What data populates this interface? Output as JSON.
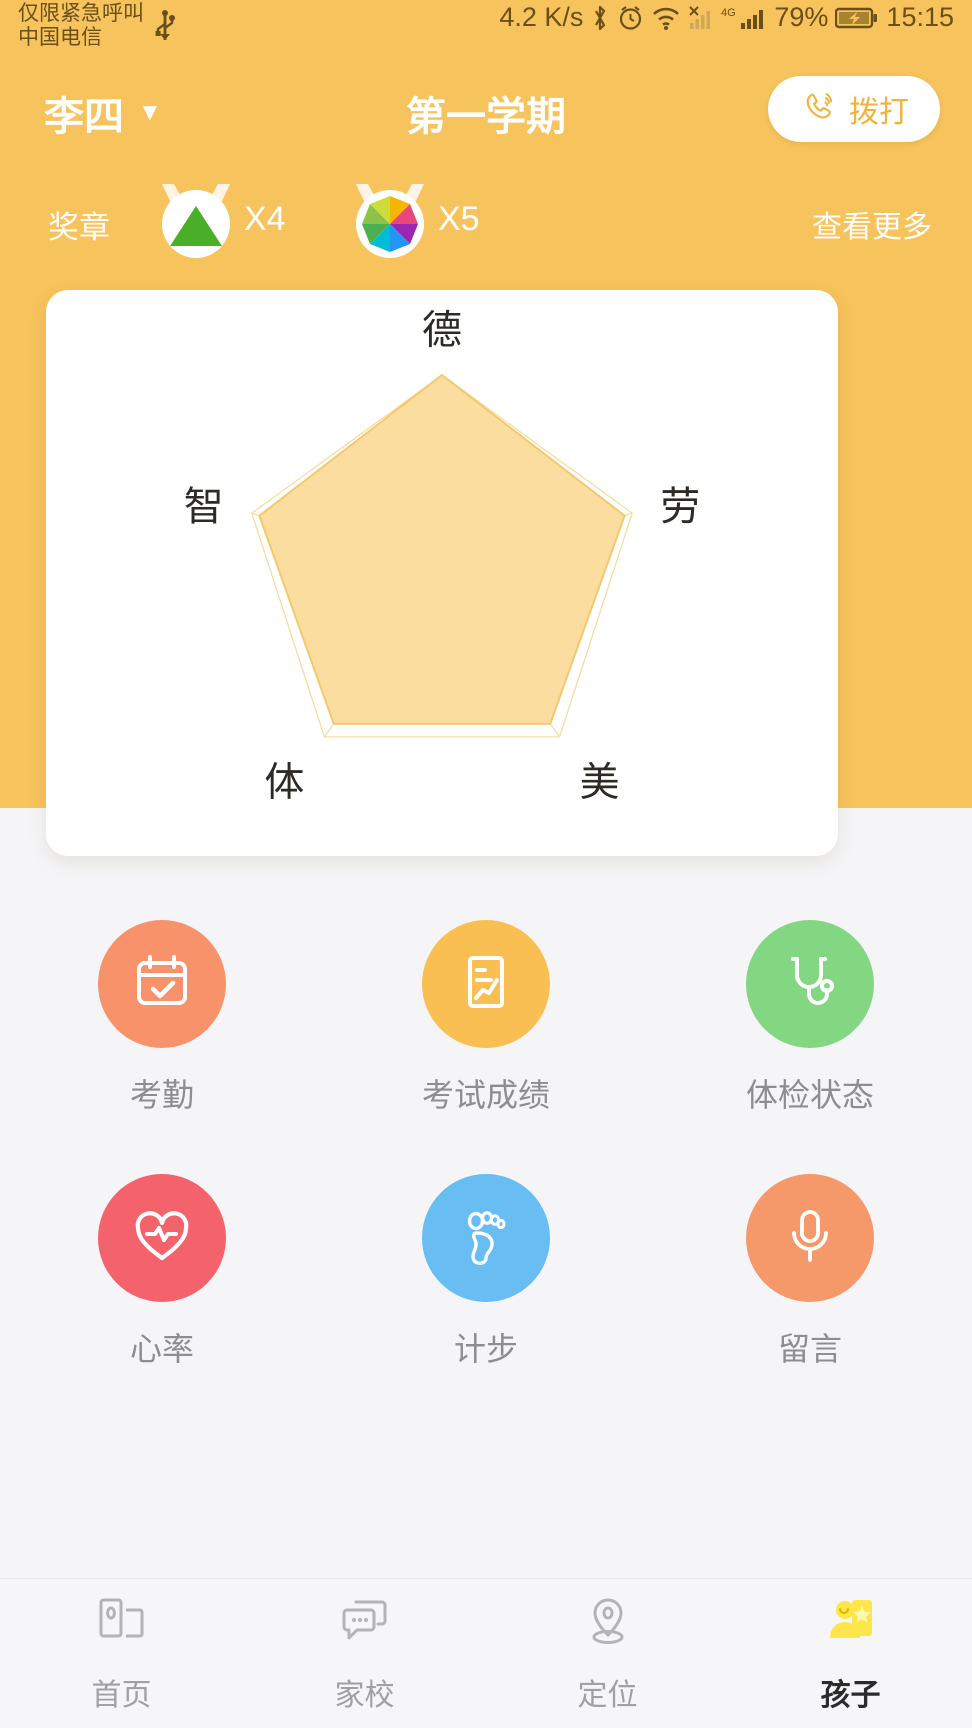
{
  "status_bar": {
    "carrier_line1": "仅限紧急呼叫",
    "carrier_line2": "中国电信",
    "usb_icon": "usb-icon",
    "net_speed": "4.2 K/s",
    "bluetooth_icon": "bluetooth-icon",
    "alarm_icon": "alarm-icon",
    "wifi_icon": "wifi-icon",
    "sim1_icon": "signal-no-service-icon",
    "network_type": "4G",
    "sim2_icon": "signal-bars-icon",
    "battery_percent": "79%",
    "battery_icon": "battery-charging-icon",
    "time": "15:15"
  },
  "header": {
    "child_name": "李四",
    "caret_icon": "chevron-down-icon",
    "term": "第一学期",
    "call_button": {
      "label": "拨打",
      "icon": "phone-call-icon"
    }
  },
  "medals": {
    "label": "奖章",
    "more_label": "查看更多",
    "items": [
      {
        "icon": "triangle-badge-icon",
        "count": "X4"
      },
      {
        "icon": "pinwheel-badge-icon",
        "count": "X5"
      }
    ]
  },
  "chart_data": {
    "type": "radar",
    "title": "",
    "categories": [
      "德",
      "劳",
      "美",
      "体",
      "智"
    ],
    "values": [
      100,
      96,
      92,
      92,
      96
    ],
    "rmax": 100,
    "rings": 5,
    "grid": true,
    "legend": "none",
    "fill_color": "#fbdda0",
    "line_color": "#f3c96e",
    "grid_color": "#f7d99c",
    "label_color": "#2e2a26"
  },
  "features": [
    {
      "label": "考勤",
      "icon": "calendar-check-icon",
      "color": "#f7926b"
    },
    {
      "label": "考试成绩",
      "icon": "report-chart-icon",
      "color": "#f9bf52"
    },
    {
      "label": "体检状态",
      "icon": "stethoscope-icon",
      "color": "#84d782"
    },
    {
      "label": "心率",
      "icon": "heart-pulse-icon",
      "color": "#f4636b"
    },
    {
      "label": "计步",
      "icon": "footprint-icon",
      "color": "#68bdf2"
    },
    {
      "label": "留言",
      "icon": "microphone-icon",
      "color": "#f6996a"
    }
  ],
  "tabbar": {
    "items": [
      {
        "label": "首页",
        "icon": "home-cards-icon",
        "active": false
      },
      {
        "label": "家校",
        "icon": "chat-bubbles-icon",
        "active": false
      },
      {
        "label": "定位",
        "icon": "location-pin-icon",
        "active": false
      },
      {
        "label": "孩子",
        "icon": "child-profile-icon",
        "active": true
      }
    ]
  },
  "colors": {
    "brand_orange": "#f7c35c",
    "accent_yellow": "#f9d71c",
    "page_bg": "#f5f5f7"
  }
}
